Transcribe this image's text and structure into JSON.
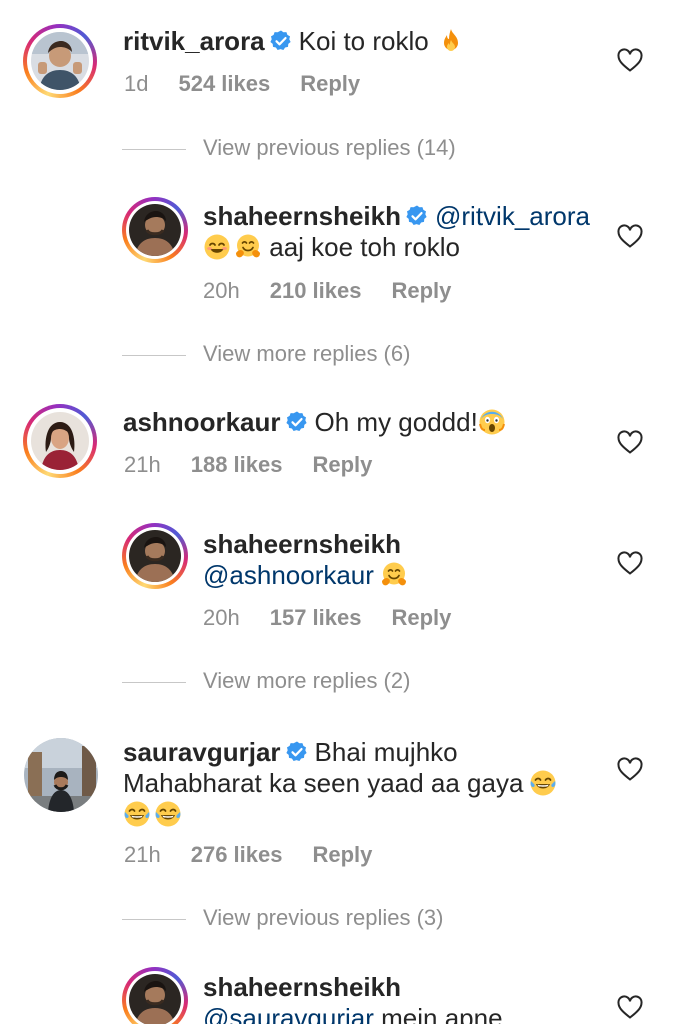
{
  "comments": [
    {
      "username": "ritvik_arora",
      "text": "Koi to roklo",
      "emojis": [
        "fire-emoji"
      ],
      "time": "1d",
      "likes": "524 likes",
      "reply": "Reply"
    },
    {
      "username": "ashnoorkaur",
      "text": "Oh my goddd!",
      "emojis": [
        "screaming-face-emoji"
      ],
      "time": "21h",
      "likes": "188 likes",
      "reply": "Reply"
    },
    {
      "username": "sauravgurjar",
      "text_line1": "Bhai mujhko",
      "text_line2": "Mahabharat ka seen yaad aa gaya",
      "emojis": [
        "tears-of-joy-emoji",
        "tears-of-joy-emoji",
        "tears-of-joy-emoji"
      ],
      "time": "21h",
      "likes": "276 likes",
      "reply": "Reply"
    }
  ],
  "replies": [
    {
      "username": "shaheernsheikh",
      "mention": "@ritvik_arora",
      "text": "aaj koe toh roklo",
      "emojis": [
        "smiling-face-emoji",
        "hugging-face-emoji"
      ],
      "time": "20h",
      "likes": "210 likes",
      "reply": "Reply"
    },
    {
      "username": "shaheernsheikh",
      "mention": "@ashnoorkaur",
      "emojis": [
        "hugging-face-emoji"
      ],
      "time": "20h",
      "likes": "157 likes",
      "reply": "Reply"
    },
    {
      "username": "shaheernsheikh",
      "mention": "@sauravgurjar",
      "text": "mein apne"
    }
  ],
  "view_links": [
    "View previous replies (14)",
    "View more replies (6)",
    "View more replies (2)",
    "View previous replies (3)"
  ],
  "colors": {
    "text": "#262626",
    "secondary": "#8e8e8e",
    "mention": "#00376b",
    "verified": "#3897f0"
  }
}
